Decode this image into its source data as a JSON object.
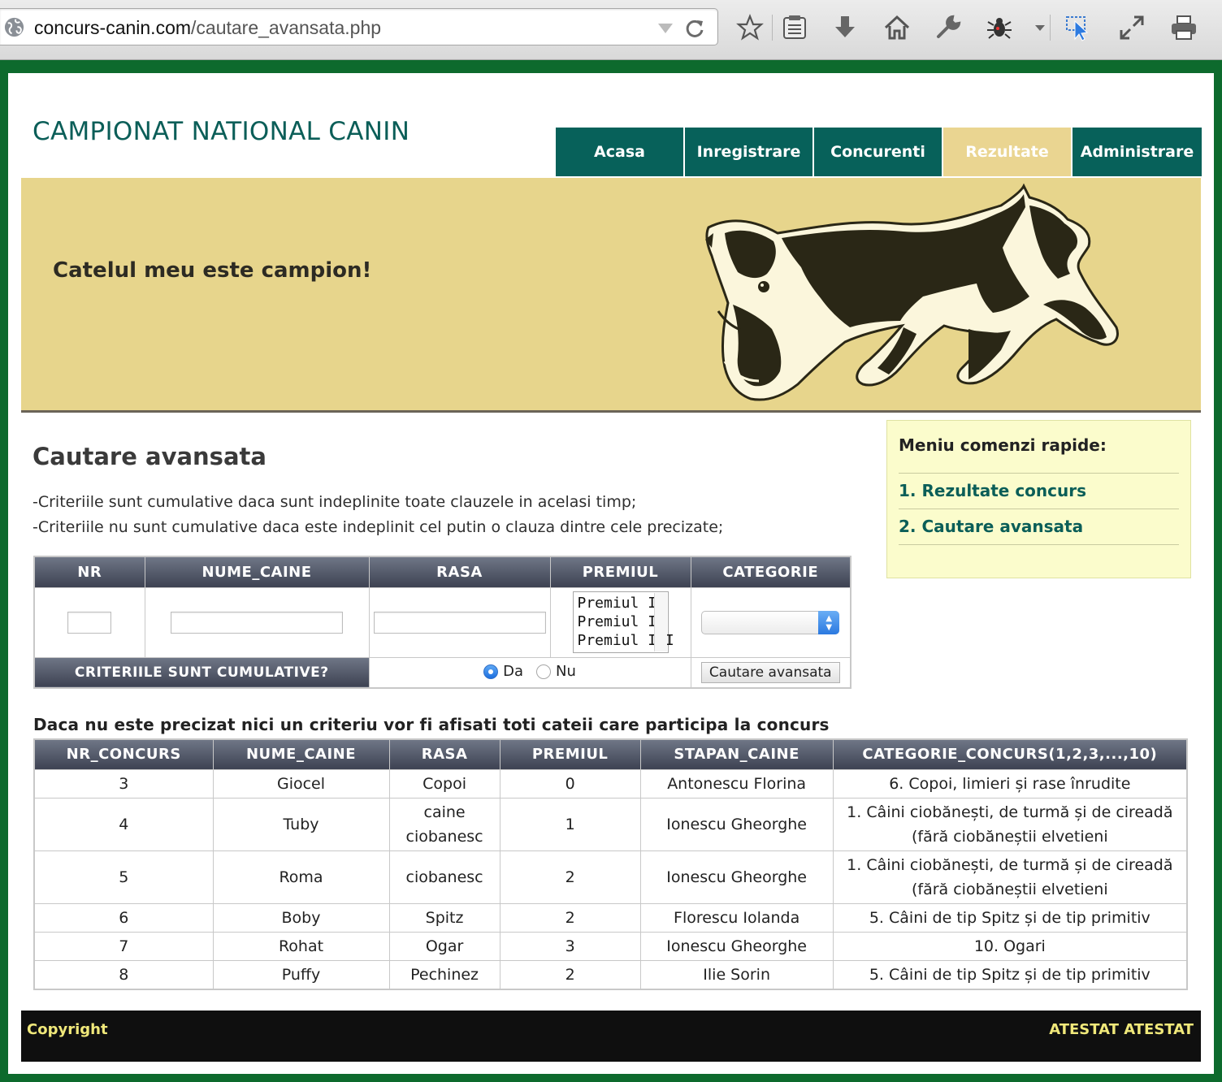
{
  "browser": {
    "url_host": "concurs-canin.com",
    "url_path": "/cautare_avansata.php"
  },
  "site": {
    "title": "CAMPIONAT NATIONAL CANIN",
    "slogan": "Catelul meu este campion!"
  },
  "nav": {
    "items": [
      {
        "label": "Acasa",
        "active": false
      },
      {
        "label": "Inregistrare",
        "active": false
      },
      {
        "label": "Concurenti",
        "active": false
      },
      {
        "label": "Rezultate",
        "active": true
      },
      {
        "label": "Administrare",
        "active": false
      }
    ]
  },
  "main": {
    "heading": "Cautare avansata",
    "notes": [
      "-Criteriile sunt cumulative daca sunt indeplinite toate clauzele in acelasi timp;",
      "-Criteriile nu sunt cumulative daca este indeplinit cel putin o clauza dintre cele precizate;"
    ]
  },
  "search": {
    "headers": [
      "NR",
      "NUME_CAINE",
      "RASA",
      "PREMIUL",
      "CATEGORIE"
    ],
    "nr_value": "",
    "nume_value": "",
    "rasa_value": "",
    "premiul_options": [
      "Premiul I",
      "Premiul II",
      "Premiul III"
    ],
    "categorie_selected": "",
    "criteria_label": "CRITERIILE SUNT CUMULATIVE?",
    "radio_da": "Da",
    "radio_nu": "Nu",
    "radio_selected": "Da",
    "submit_label": "Cautare avansata"
  },
  "sidebar": {
    "title": "Meniu comenzi rapide:",
    "links": [
      "1. Rezultate concurs",
      "2. Cautare avansata"
    ]
  },
  "results": {
    "caption": "Daca nu este precizat nici un criteriu vor fi afisati toti cateii care participa la concurs",
    "headers": [
      "NR_CONCURS",
      "NUME_CAINE",
      "RASA",
      "PREMIUL",
      "STAPAN_CAINE",
      "CATEGORIE_CONCURS(1,2,3,...,10)"
    ],
    "rows": [
      [
        "3",
        "Giocel",
        "Copoi",
        "0",
        "Antonescu Florina",
        "6. Copoi, limieri și rase înrudite"
      ],
      [
        "4",
        "Tuby",
        "caine ciobanesc",
        "1",
        "Ionescu Gheorghe",
        "1. Câini ciobănești, de turmă și de cireadă (fără ciobăneștii elvetieni"
      ],
      [
        "5",
        "Roma",
        "ciobanesc",
        "2",
        "Ionescu Gheorghe",
        "1. Câini ciobănești, de turmă și de cireadă (fără ciobăneștii elvetieni"
      ],
      [
        "6",
        "Boby",
        "Spitz",
        "2",
        "Florescu Iolanda",
        "5. Câini de tip Spitz și de tip primitiv"
      ],
      [
        "7",
        "Rohat",
        "Ogar",
        "3",
        "Ionescu Gheorghe",
        "10. Ogari"
      ],
      [
        "8",
        "Puffy",
        "Pechinez",
        "2",
        "Ilie Sorin",
        "5. Câini de tip Spitz și de tip primitiv"
      ]
    ]
  },
  "footer": {
    "left": "Copyright",
    "right": "ATESTAT ATESTAT"
  },
  "colors": {
    "frame": "#0d6a2d",
    "nav": "#07615a",
    "nav_active": "#ead591",
    "banner": "#e7d58c",
    "sidebar": "#fbfccc",
    "footer": "#0f0f0f",
    "footer_text": "#f0e87a"
  },
  "icons": [
    "globe-icon",
    "dropdown-arrow-icon",
    "reload-icon",
    "star-icon",
    "bookmarks-list-icon",
    "download-icon",
    "home-icon",
    "wrench-icon",
    "bug-icon",
    "pointer-icon",
    "fullscreen-icon",
    "print-icon",
    "dog-illustration"
  ]
}
